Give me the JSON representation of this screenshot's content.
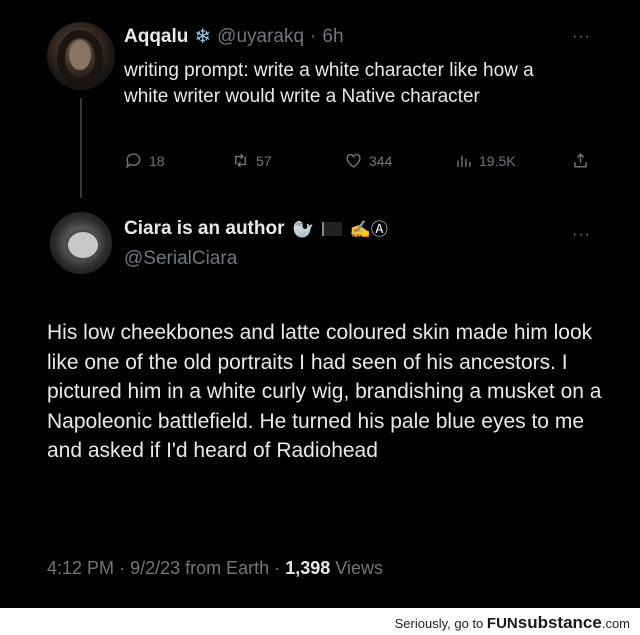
{
  "tweet1": {
    "name": "Aqqalu",
    "badge": "❄",
    "handle": "@uyarakq",
    "separator": "·",
    "time": "6h",
    "more": "···",
    "text": "writing prompt: write a white character like how a white writer would write a Native character",
    "actions": {
      "replies": "18",
      "retweets": "57",
      "likes": "344",
      "views": "19.5K"
    }
  },
  "tweet2": {
    "name": "Ciara is an author",
    "emojis": [
      "🦭",
      "✍️Ⓐ"
    ],
    "handle": "@SerialCiara",
    "more": "···",
    "text": "His low cheekbones and latte coloured skin made him look like one of the old portraits I had seen of his ancestors. I pictured him in a white curly wig, brandishing a musket on a Napoleonic battlefield. He turned his pale blue eyes to me and asked if I'd heard of Radiohead",
    "meta": {
      "time": "4:12 PM",
      "sep1": "·",
      "date": "9/2/23",
      "source": "from Earth",
      "sep2": "·",
      "views_count": "1,398",
      "views_label": "Views"
    }
  },
  "footer": {
    "prefix": "Seriously, go to",
    "brand_a": "FUN",
    "brand_b": "substance",
    "brand_c": ".com"
  },
  "colors": {
    "background": "#000000",
    "text": "#e7e9ea",
    "muted": "#71767b",
    "footer_bg": "#ffffff"
  }
}
